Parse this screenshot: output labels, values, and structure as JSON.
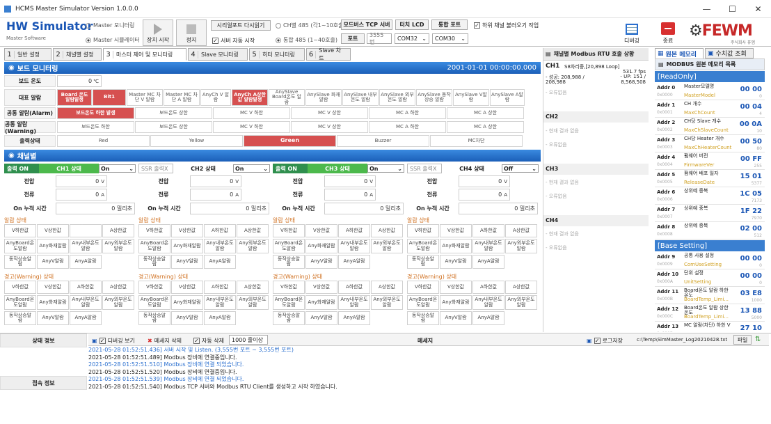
{
  "window": {
    "title": "HCMS Master Simulator Version 1.0.0.0",
    "min": "—",
    "max": "☐",
    "close": "✕"
  },
  "brand": {
    "title": "HW Simulator",
    "subtitle": "Master Software"
  },
  "header": {
    "radio_master_monitor": "Master 모니터링",
    "radio_master_sim": "Master 시뮬레이터",
    "btn_start": "장치 시작",
    "btn_stop": "정지",
    "btn_serial_reload": "시리얼포트 다시읽기",
    "radio_ch485": "CH별 485 (각1~10호출)",
    "radio_integrated485": "통합 485 (1~40호출)",
    "chk_server_auto": "서버 자동 시작",
    "lbl_modbus_tcp": "모드버스 TCP 서버",
    "lbl_touch_lcd": "터치 LCD",
    "lbl_int_port": "통합 포트",
    "chk_sub_channel": "하위 채널 불러오기 작업",
    "lbl_port": "포트",
    "port_value": "3555 번",
    "com1": "COM32",
    "com2": "COM30",
    "btn_debug": "디버깅",
    "btn_exit": "종료",
    "logo": "FEWM",
    "logo_sub": "주식회사 퓨엠"
  },
  "tabs": [
    {
      "num": "1",
      "label": "일반 설정"
    },
    {
      "num": "2",
      "label": "채널별 설정"
    },
    {
      "num": "3",
      "label": "마스터 제어 및 모니터링"
    },
    {
      "num": "4",
      "label": "Slave 모니터링"
    },
    {
      "num": "5",
      "label": "히터 모니터링"
    },
    {
      "num": "6",
      "label": "Slave 차트"
    }
  ],
  "board": {
    "section": "보드 모니터링",
    "datetime": "2001-01-01 00:00:00.000",
    "temp_label": "보드 온도",
    "temp_value": "0",
    "temp_unit": "℃",
    "rep_alarm_label": "대표 알람",
    "rep_alarm": [
      "Board 온도\n알람발생",
      "Bit1",
      "Master MC 차\n단 V 알람",
      "Master MC 차\n단 A 알람",
      "AnyCh V 알람",
      "AnyCh A상한\n값 알람발생",
      "AnySlave\nBoard온도 알\n람",
      "AnySlave 화재\n알람",
      "AnySlave 내부\n온도 알람",
      "AnySlave 외부\n온도 알람",
      "AnySlave 동작\n상승 알람",
      "AnySlave V알\n람",
      "AnySlave A알\n람"
    ],
    "rep_alarm_small": "Board 온도\n알람발생",
    "common_alarm_label": "공통 알람(Alarm)",
    "common_alarm": [
      "보드온도 하한 발생",
      "보드온도 상한",
      "MC V 하한",
      "MC V 상한",
      "MC A 하한",
      "MC A 상한"
    ],
    "common_warn_label": "공통 알람(Warning)",
    "common_warn": [
      "보드온도 하한",
      "보드온도 상한",
      "MC V 하한",
      "MC V 상한",
      "MC A 하한",
      "MC A 상한"
    ],
    "output_label": "출력상태",
    "output": [
      "Red",
      "Yellow",
      "Green",
      "Buzzer",
      "MC차단"
    ]
  },
  "channel": {
    "section": "채널별",
    "channels": [
      {
        "out": "출력 ON",
        "state": "CH1 상태",
        "sel": "On",
        "v": "0",
        "a": "0",
        "time": "0 밀리초"
      },
      {
        "out": "SSR 출력X",
        "state": "CH2 상태",
        "sel": "On",
        "v": "0",
        "a": "0",
        "time": "0 밀리초"
      },
      {
        "out": "출력 ON",
        "state": "CH3 상태",
        "sel": "On",
        "v": "0",
        "a": "0",
        "time": "0 밀리초"
      },
      {
        "out": "SSR 출력X",
        "state": "CH4 상태",
        "sel": "Off",
        "v": "0",
        "a": "0",
        "time": "0 밀리초"
      }
    ],
    "lbl_voltage": "전압",
    "lbl_current": "전류",
    "lbl_ontime": "On 누적 시간",
    "unit_v": "V",
    "unit_a": "A",
    "alarm_title": "알람 상태",
    "warn_title": "경고(Warning) 상태",
    "alarm_row1": [
      "V하한값",
      "V상한값",
      "A하한값발\n생",
      "A상한값"
    ],
    "alarm_row1_plain": [
      "V하한값",
      "V상한값",
      "A하한값",
      "A상한값"
    ],
    "alarm_row2": [
      "AnyBoard온\n도알람",
      "Any화재알람",
      "Any내부온도\n알람",
      "Any외부온도\n알람"
    ],
    "alarm_row3": [
      "동작상승알\n람",
      "AnyV알람",
      "AnyA알람"
    ]
  },
  "rtu": {
    "title": "채널별 Modbus RTU 호출 상황",
    "ch1": {
      "name": "CH1",
      "desc": "S8차리중,[20,898 Loop]",
      "fps": "531.7 fps",
      "succ": "- 성공: 208,988 /",
      "succ2": "208,988",
      "up": "- UP: 151 /",
      "up2": "8,568,508",
      "none": "- 오류없음"
    },
    "ch2": {
      "name": "CH2",
      "r1": "- 현재 결과 없음",
      "r2": "- 오류없음"
    },
    "ch3": {
      "name": "CH3",
      "r1": "- 현재 결과 없음",
      "r2": "- 오류없음"
    },
    "ch4": {
      "name": "CH4",
      "r1": "- 현재 결과 없음",
      "r2": "- 오류없음"
    }
  },
  "memory": {
    "tab1": "원본 메모리",
    "tab2": "수치값 조회",
    "heading": "MODBUS 원본 메모리 목록",
    "readonly": "[ReadOnly]",
    "base": "[Base Setting]",
    "rows": [
      {
        "n": "Addr 0",
        "a": "0x0000",
        "t": "Master모델명",
        "k": "MasterModel",
        "v": "00 00",
        "d": "0"
      },
      {
        "n": "Addr 1",
        "a": "0x0001",
        "t": "CH 개수",
        "k": "MaxChCount",
        "v": "00 04",
        "d": "4"
      },
      {
        "n": "Addr 2",
        "a": "0x0002",
        "t": "CH당 Slave 개수",
        "k": "MaxChSlaveCount",
        "v": "00 0A",
        "d": "10"
      },
      {
        "n": "Addr 3",
        "a": "0x0003",
        "t": "CH당 Heater 개수",
        "k": "MaxChHeaterCount",
        "v": "00 50",
        "d": "80"
      },
      {
        "n": "Addr 4",
        "a": "0x0004",
        "t": "펌웨어 버전",
        "k": "FirmwareVer",
        "v": "00 FF",
        "d": "255"
      },
      {
        "n": "Addr 5",
        "a": "0x0005",
        "t": "펌웨어 배포 일자",
        "k": "ReleaseDate",
        "v": "15 01",
        "d": "5377"
      },
      {
        "n": "Addr 6",
        "a": "0x0006",
        "t": "상위예 중복",
        "k": "",
        "v": "1C 05",
        "d": "7173"
      },
      {
        "n": "Addr 7",
        "a": "0x0007",
        "t": "상위예 중복",
        "k": "",
        "v": "1F 22",
        "d": "7970"
      },
      {
        "n": "Addr 8",
        "a": "0x0008",
        "t": "상위예 중복",
        "k": "",
        "v": "02 00",
        "d": "512"
      },
      {
        "n": "Addr 9",
        "a": "0x0009",
        "t": "공통 사용 설정",
        "k": "ComUseSetting",
        "v": "00 00",
        "d": "0"
      },
      {
        "n": "Addr 10",
        "a": "0x000A",
        "t": "단위 설정",
        "k": "UnitSetting",
        "v": "00 00",
        "d": "0"
      },
      {
        "n": "Addr 11",
        "a": "0x000B",
        "t": "Board온도 알람 하한 온도",
        "k": "BoardTemp_Limi...",
        "v": "03 E8",
        "d": "1000"
      },
      {
        "n": "Addr 12",
        "a": "0x000C",
        "t": "Board온도 알람 상한 온도",
        "k": "BoardTemp_Limi...",
        "v": "13 88",
        "d": "5000"
      },
      {
        "n": "Addr 13",
        "a": "0x000D",
        "t": "MC 알람(차단) 하한 V",
        "k": "",
        "v": "27 10",
        "d": ""
      }
    ]
  },
  "status": {
    "lbl_state": "상태 정보",
    "lbl_conn": "접속 정보",
    "chk_debug": "디버깅 보기",
    "btn_del": "메세지 삭제",
    "chk_autodel": "자동 삭제",
    "autodel_val": "1000 줄이상",
    "msg_title": "메세지",
    "chk_logsave": "로그저장",
    "log_path": "c:\\Temp\\SimMaster_Log20210428.txt",
    "btn_file": "파일"
  },
  "log": [
    {
      "t": "2021-05-28 01:52:51.436] 서버 시작 및 Listen. (3,555번 포트 ~ 3,555번 포트)",
      "c": "#2a6fcf"
    },
    {
      "t": "2021-05-28 01:52:51.489] Modbus 장비에 연결중입니다.",
      "c": "#222"
    },
    {
      "t": "2021-05-28 01:52:51.510] Modbus 장비에 연결 되었습니다.",
      "c": "#2a6fcf"
    },
    {
      "t": "2021-05-28 01:52:51.520] Modbus 장비에 연결중입니다.",
      "c": "#222"
    },
    {
      "t": "2021-05-28 01:52:51.539] Modbus 장비에 연결 되었습니다.",
      "c": "#2a6fcf"
    },
    {
      "t": "2021-05-28 01:52:51.540] Modbus TCP 서버와 Modbus RTU Client를 생성하고 시작 하였습니다.",
      "c": "#222"
    }
  ]
}
